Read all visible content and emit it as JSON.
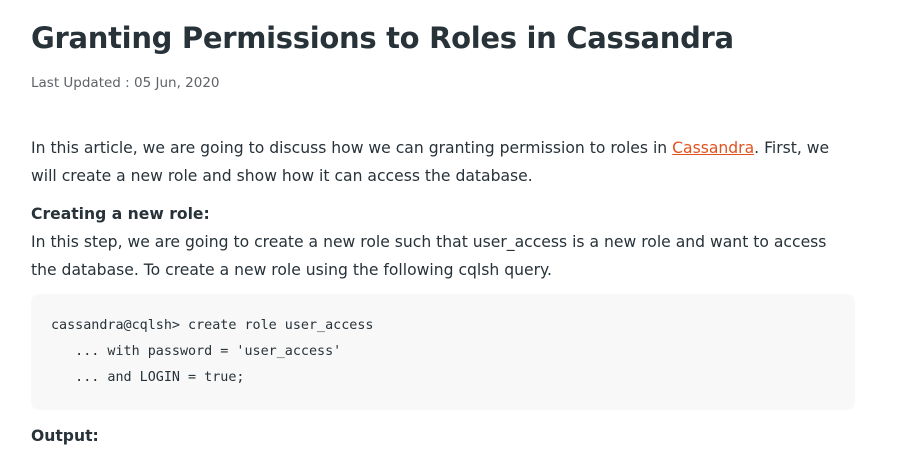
{
  "article": {
    "title": "Granting Permissions to Roles in Cassandra",
    "last_updated": "Last Updated : 05 Jun, 2020",
    "intro_before_link": "In this article, we are going to discuss how we can granting permission to roles in ",
    "intro_link": "Cassandra",
    "intro_after_link": ". First, we will create a new role and show how it can access the database.",
    "section_heading": "Creating a new role:",
    "section_text": "In this step, we are going to create a new role such that user_access is a new role and want to access the database. To create a new role using the following cqlsh query.",
    "code_lines": [
      "cassandra@cqlsh> create role user_access",
      "   ... with password = 'user_access'",
      "   ... and LOGIN = true;"
    ],
    "output_heading": "Output:"
  },
  "colors": {
    "text": "#273239",
    "link": "#e2521f",
    "code_background": "#f8f8f8",
    "meta": "#5f6368"
  }
}
